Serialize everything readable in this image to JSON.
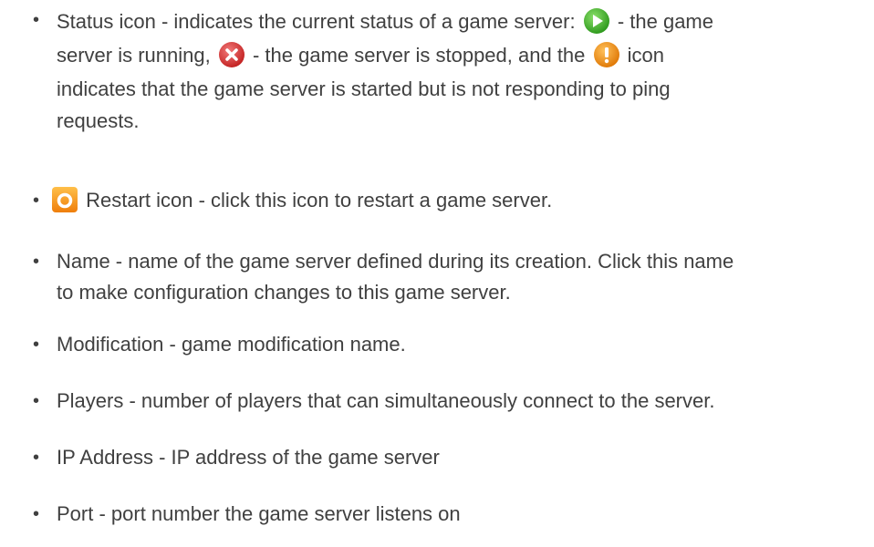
{
  "items": [
    {
      "id": "status",
      "lines": [
        {
          "before": "Status icon - indicates the current status of a game server: ",
          "icon": "play-icon",
          "after": " - the game"
        },
        {
          "before": "server is running, ",
          "icon": "error-icon",
          "after": " - the game server is stopped, and the ",
          "icon2": "warning-icon",
          "after2": " icon"
        },
        {
          "text": "indicates that the game server is started but is not responding to ping"
        },
        {
          "text": "requests."
        }
      ]
    },
    {
      "id": "restart",
      "icon": "restart-icon",
      "text": " Restart icon - click this icon to restart a game server."
    },
    {
      "id": "name",
      "lines": [
        {
          "text": "Name - name of the game server defined during its creation. Click this name"
        },
        {
          "text": "to make configuration changes to this game server."
        }
      ]
    },
    {
      "id": "modification",
      "text": "Modification - game modification name."
    },
    {
      "id": "players",
      "text": "Players - number of players that can simultaneously connect to the server."
    },
    {
      "id": "ip",
      "text": "IP Address - IP address of the game server"
    },
    {
      "id": "port",
      "text": "Port - port number the game server listens on"
    }
  ],
  "bullet_char": "•",
  "colors": {
    "text": "#404040",
    "play": "#3fae2a",
    "error": "#d83a3a",
    "warning": "#f08a10",
    "restart": "#f59a1e"
  }
}
